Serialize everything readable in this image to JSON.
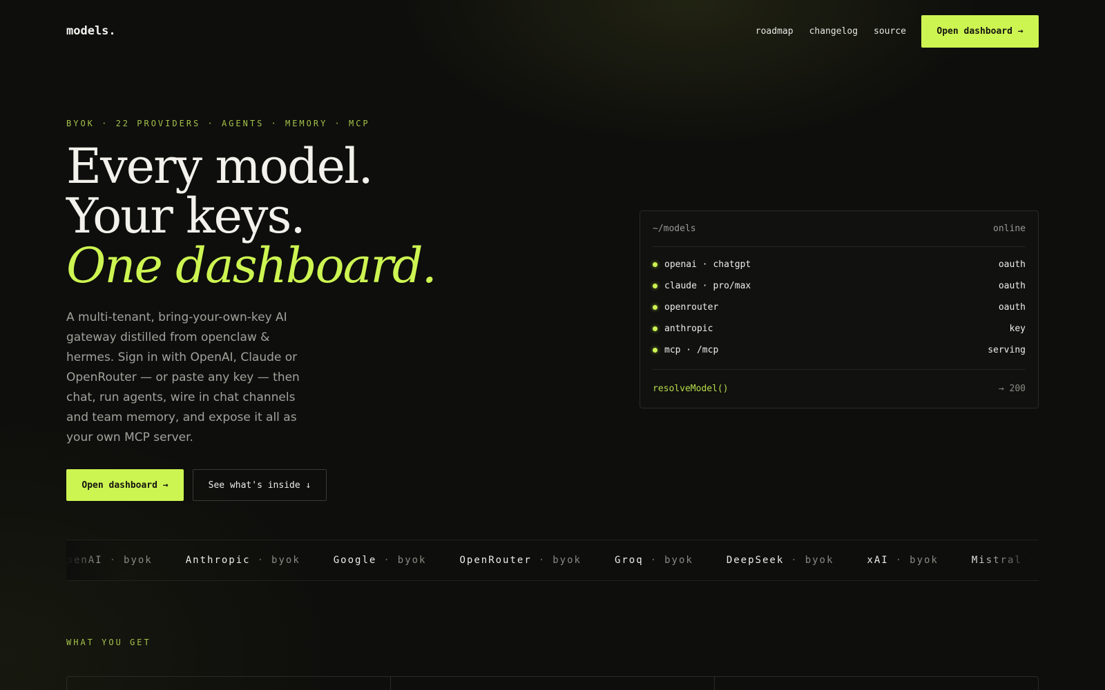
{
  "nav": {
    "logo": "models.",
    "links": [
      "roadmap",
      "changelog",
      "source"
    ],
    "cta": "Open dashboard →"
  },
  "hero": {
    "eyebrow": "BYOK · 22 PROVIDERS · AGENTS · MEMORY · MCP",
    "headline_line1": "Every model.",
    "headline_line2": "Your keys.",
    "headline_line3": "One dashboard.",
    "lede": "A multi-tenant, bring-your-own-key AI gateway distilled from openclaw & hermes. Sign in with OpenAI, Claude or OpenRouter — or paste any key — then chat, run agents, wire in chat channels and team memory, and expose it all as your own MCP server.",
    "primary_button": "Open dashboard →",
    "secondary_button": "See what's inside ↓"
  },
  "terminal": {
    "path": "~/models",
    "status": "online",
    "rows": [
      {
        "name": "openai · chatgpt",
        "auth": "oauth"
      },
      {
        "name": "claude · pro/max",
        "auth": "oauth"
      },
      {
        "name": "openrouter",
        "auth": "oauth"
      },
      {
        "name": "anthropic",
        "auth": "key"
      },
      {
        "name": "mcp · /mcp",
        "auth": "serving"
      }
    ],
    "footer_fn": "resolveModel()",
    "footer_status": "→ 200"
  },
  "marquee": {
    "separator": "·",
    "tag": "byok",
    "providers": [
      "OpenAI",
      "Anthropic",
      "Google",
      "OpenRouter",
      "Groq",
      "DeepSeek",
      "xAI",
      "Mistral"
    ]
  },
  "section": {
    "label": "WHAT YOU GET"
  },
  "colors": {
    "background": "#0e0e0c",
    "accent": "#cdf552",
    "eyebrow": "#a4c24a",
    "muted_text": "#a2a29c"
  }
}
